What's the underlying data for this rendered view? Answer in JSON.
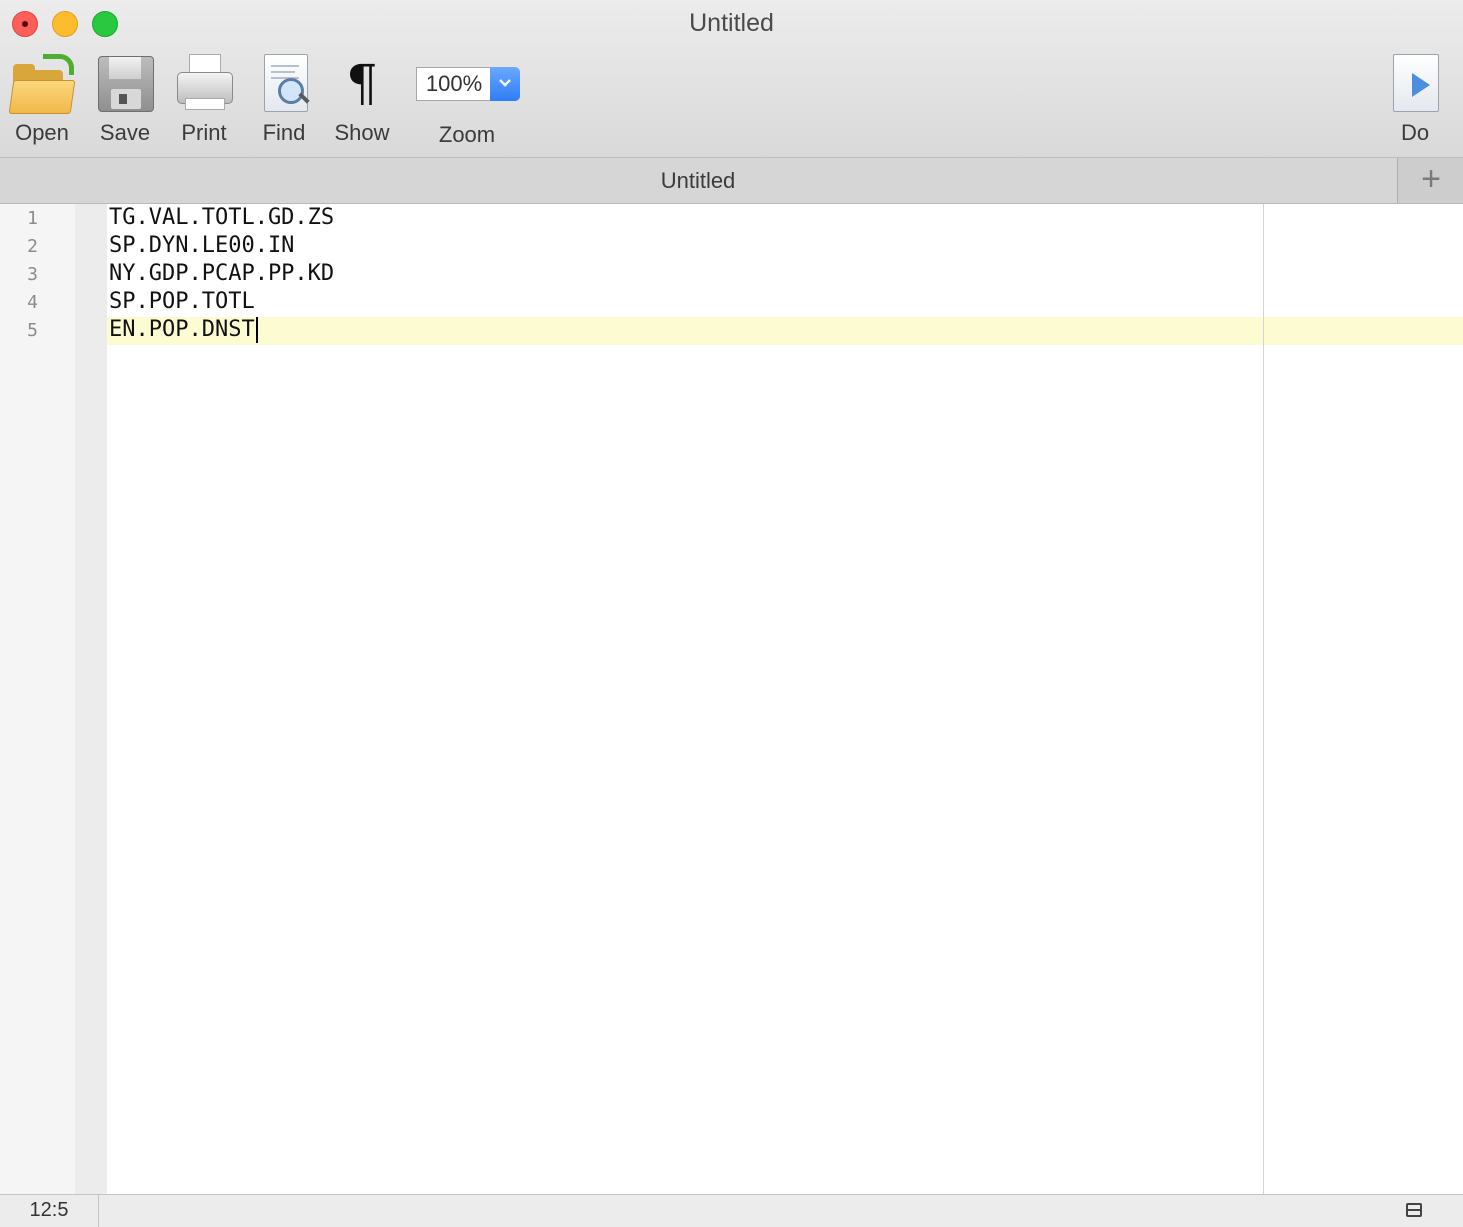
{
  "window": {
    "title": "Untitled"
  },
  "toolbar": {
    "open_label": "Open",
    "save_label": "Save",
    "print_label": "Print",
    "find_label": "Find",
    "show_label": "Show",
    "show_icon_glyph": "¶",
    "zoom_label": "Zoom",
    "zoom_value": "100%",
    "do_label": "Do",
    "icons": {
      "open": "open-folder-icon",
      "save": "floppy-disk-icon",
      "print": "printer-icon",
      "find": "document-magnifier-icon",
      "show": "pilcrow-icon",
      "zoom": "chevron-down-icon",
      "do": "document-play-icon"
    }
  },
  "tabs": {
    "active_title": "Untitled",
    "add_glyph": "+"
  },
  "editor": {
    "line_numbers": [
      "1",
      "2",
      "3",
      "4",
      "5"
    ],
    "lines": [
      "TG.VAL.TOTL.GD.ZS",
      "SP.DYN.LE00.IN",
      "NY.GDP.PCAP.PP.KD",
      "SP.POP.TOTL",
      "EN.POP.DNST"
    ],
    "current_line": 5,
    "current_line_color": "#fdfbd2"
  },
  "statusbar": {
    "cursor_position": "12:5",
    "split_icon": "split-view-icon"
  },
  "colors": {
    "close": "#fc5f57",
    "minimize": "#fdbc2e",
    "maximize": "#28c840",
    "zoom_accent": "#2f7cf6"
  }
}
